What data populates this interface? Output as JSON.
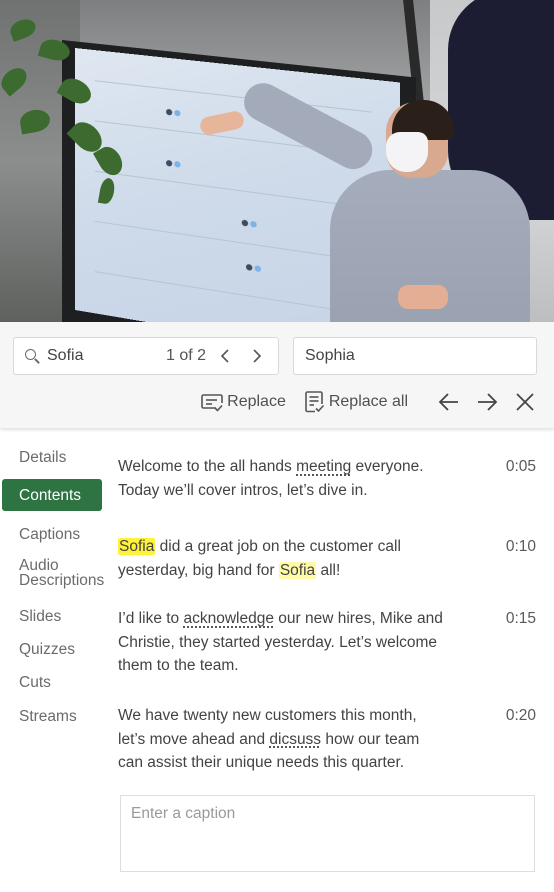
{
  "video": {
    "description": "Woman in a face mask presenting a dashboard on a large wall-mounted screen"
  },
  "find_replace": {
    "find_value": "Sofia",
    "match_counter": "1 of 2",
    "replace_value": "Sophia",
    "replace_label": "Replace",
    "replace_all_label": "Replace all",
    "icons": {
      "search": "search-icon",
      "prev_match": "chevron-left-icon",
      "next_match": "chevron-right-icon",
      "replace": "replace-icon",
      "replace_all": "replace-all-icon",
      "back": "arrow-left-icon",
      "forward": "arrow-right-icon",
      "close": "close-icon"
    }
  },
  "side_nav": {
    "items": [
      {
        "label": "Details",
        "active": false
      },
      {
        "label": "Contents",
        "active": true
      },
      {
        "label": "Captions",
        "active": false
      },
      {
        "label": "Audio Descriptions",
        "label_line1": "Audio",
        "label_line2": "Descriptions",
        "active": false
      },
      {
        "label": "Slides",
        "active": false
      },
      {
        "label": "Quizzes",
        "active": false
      },
      {
        "label": "Cuts",
        "active": false
      },
      {
        "label": "Streams",
        "active": false
      }
    ],
    "active_color": "#2e7443"
  },
  "transcript": {
    "entries": [
      {
        "time": "0:05",
        "segments": [
          {
            "t": "Welcome to the all hands "
          },
          {
            "t": "meeting",
            "style": "spell"
          },
          {
            "t": " everyone. Today we’ll cover intros, let’s dive in."
          }
        ]
      },
      {
        "time": "0:10",
        "segments": [
          {
            "t": "Sofia",
            "style": "current-match"
          },
          {
            "t": " did a great job on the customer call yesterday, big hand for "
          },
          {
            "t": "Sofia",
            "style": "match"
          },
          {
            "t": " all!"
          }
        ]
      },
      {
        "time": "0:15",
        "segments": [
          {
            "t": "I’d like to "
          },
          {
            "t": "acknowledge",
            "style": "spell"
          },
          {
            "t": " our new hires, Mike and Christie, they started yesterday. Let’s welcome them to the team."
          }
        ]
      },
      {
        "time": "0:20",
        "segments": [
          {
            "t": "We have twenty new customers this month, let’s move ahead and "
          },
          {
            "t": "dicsuss",
            "style": "spell"
          },
          {
            "t": " how our team can assist their unique needs this quarter."
          }
        ]
      }
    ],
    "highlight_colors": {
      "current_match": "#fff23a",
      "match": "#fffaa8"
    }
  },
  "caption_input": {
    "placeholder": "Enter a caption",
    "value": ""
  }
}
